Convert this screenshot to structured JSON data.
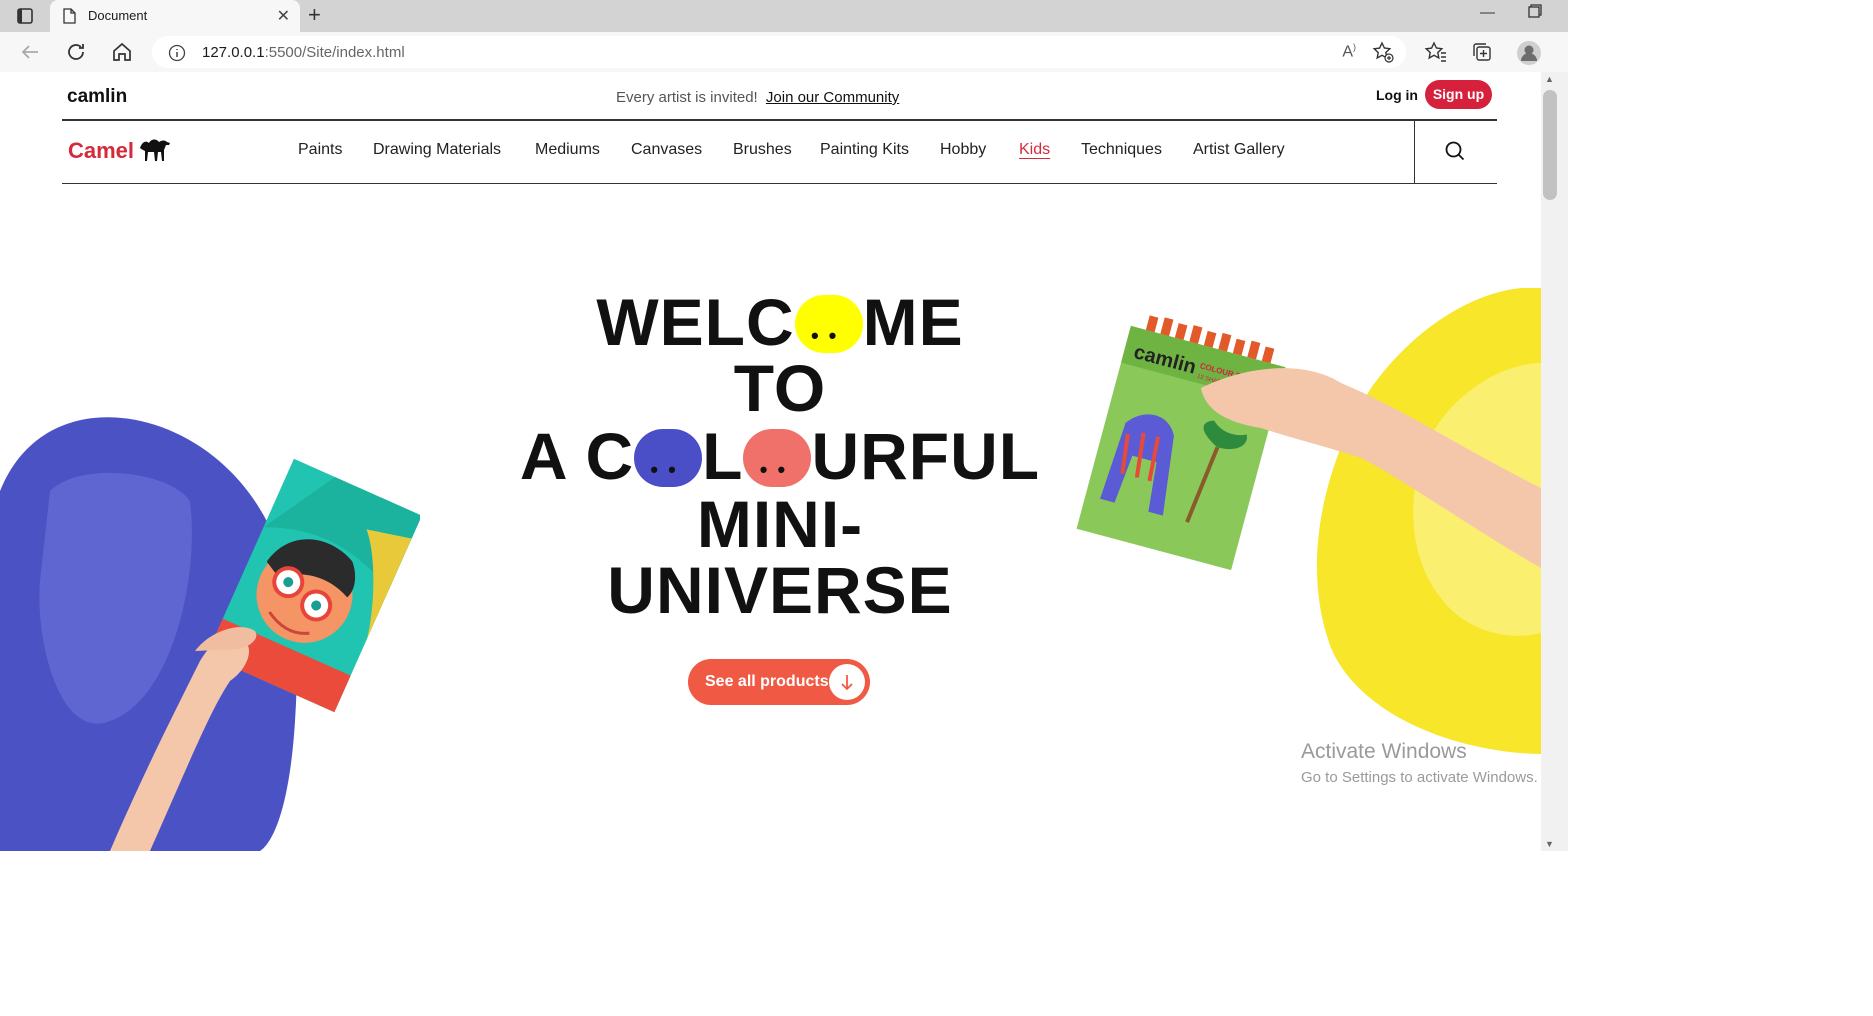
{
  "browser": {
    "tab_title": "Document",
    "new_tab": "+",
    "url_host": "127.0.0.1",
    "url_path": ":5500/Site/index.html"
  },
  "header": {
    "brand": "camlin",
    "promo_text": "Every artist is invited!",
    "promo_link": "Join our Community",
    "login": "Log in",
    "signup": "Sign up"
  },
  "nav": {
    "logo": "Camel",
    "items": [
      "Paints",
      "Drawing Materials",
      "Mediums",
      "Canvases",
      "Brushes",
      "Painting Kits",
      "Hobby",
      "Kids",
      "Techniques",
      "Artist Gallery"
    ],
    "active": "Kids"
  },
  "hero": {
    "line1_a": "WELC",
    "line1_b": "ME",
    "line2": "TO",
    "line3_a": "A C",
    "line3_b": "L",
    "line3_c": "URFUL",
    "line4": "MINI-",
    "line5": "UNIVERSE",
    "cta": "See all products",
    "colors": {
      "yellow": "#ffff00",
      "blue": "#4a4fc8",
      "salmon": "#f0706a"
    }
  },
  "product_box": {
    "brand": "camlin",
    "label": "COLOUR PENCILS",
    "shades": "12 SHADES"
  },
  "overlay": {
    "activate_title": "Activate Windows",
    "activate_sub": "Go to Settings to activate Windows."
  }
}
